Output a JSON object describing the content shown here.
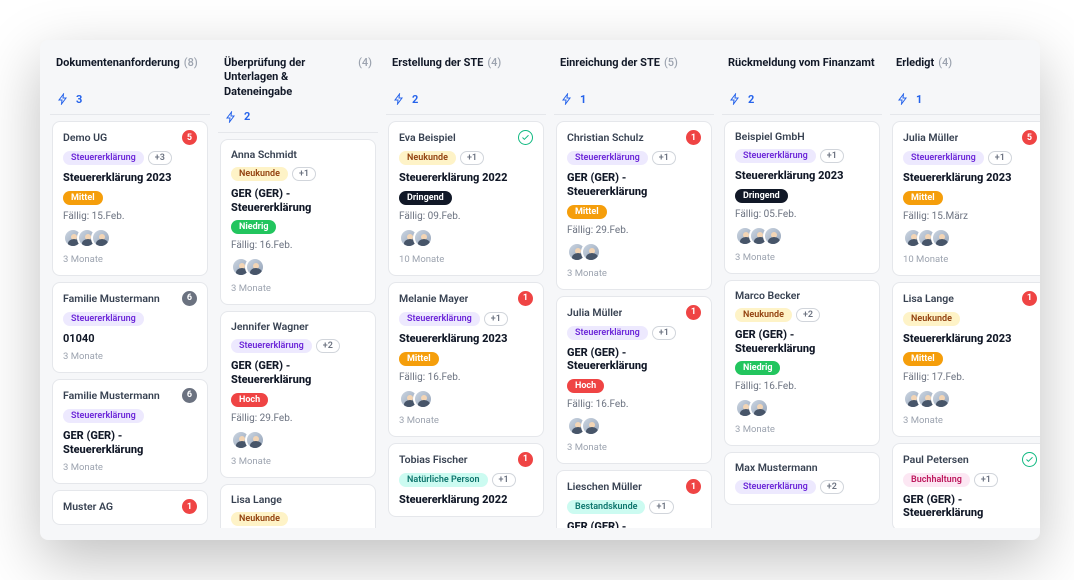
{
  "columns": [
    {
      "title": "Dokumentenanforderung",
      "count": "(8)",
      "filter": "3",
      "cards": [
        {
          "client": "Demo UG",
          "badge": {
            "type": "num",
            "color": "red",
            "value": "5"
          },
          "tags": [
            {
              "text": "Steuererklärung",
              "color": "purple"
            }
          ],
          "plus": "+3",
          "title": "Steuererklärung 2023",
          "prio": {
            "label": "Mittel",
            "class": "prio-mittel"
          },
          "due": "Fällig: 15.Feb.",
          "avatars": 3,
          "meta": "3 Monate"
        },
        {
          "client": "Familie Mustermann",
          "badge": {
            "type": "num",
            "color": "gray",
            "value": "6"
          },
          "tags": [
            {
              "text": "Steuererklärung",
              "color": "purple"
            }
          ],
          "title_code": "01040",
          "meta": "3 Monate"
        },
        {
          "client": "Familie Mustermann",
          "badge": {
            "type": "num",
            "color": "gray",
            "value": "6"
          },
          "tags": [
            {
              "text": "Steuererklärung",
              "color": "purple"
            }
          ],
          "title": "GER (GER) - Steuererklärung",
          "meta": "3 Monate"
        },
        {
          "client": "Muster AG",
          "badge": {
            "type": "num",
            "color": "red",
            "value": "1"
          }
        }
      ]
    },
    {
      "title": "Überprüfung der Unterlagen & Dateneingabe",
      "count": "(4)",
      "filter": "2",
      "cards": [
        {
          "client": "Anna Schmidt",
          "tags": [
            {
              "text": "Neukunde",
              "color": "yellow"
            }
          ],
          "plus": "+1",
          "title": "GER (GER) - Steuererklärung",
          "prio": {
            "label": "Niedrig",
            "class": "prio-niedrig"
          },
          "due": "Fällig: 16.Feb.",
          "avatars": 2,
          "meta": "3 Monate"
        },
        {
          "client": "Jennifer Wagner",
          "tags": [
            {
              "text": "Steuererklärung",
              "color": "purple"
            }
          ],
          "plus": "+2",
          "title": "GER (GER) - Steuererklärung",
          "prio": {
            "label": "Hoch",
            "class": "prio-hoch"
          },
          "due": "Fällig: 29.Feb.",
          "avatars": 2,
          "meta": "3 Monate"
        },
        {
          "client": "Lisa Lange",
          "tags": [
            {
              "text": "Neukunde",
              "color": "yellow"
            }
          ]
        }
      ]
    },
    {
      "title": "Erstellung der STE",
      "count": "(4)",
      "filter": "2",
      "cards": [
        {
          "client": "Eva Beispiel",
          "badge": {
            "type": "check"
          },
          "tags": [
            {
              "text": "Neukunde",
              "color": "yellow"
            }
          ],
          "plus": "+1",
          "title": "Steuererklärung 2022",
          "prio": {
            "label": "Dringend",
            "class": "prio-dringend"
          },
          "due": "Fällig: 09.Feb.",
          "avatars": 2,
          "meta": "10 Monate"
        },
        {
          "client": "Melanie Mayer",
          "badge": {
            "type": "num",
            "color": "red",
            "value": "1"
          },
          "tags": [
            {
              "text": "Steuererklärung",
              "color": "purple"
            }
          ],
          "plus": "+1",
          "title": "Steuererklärung 2023",
          "prio": {
            "label": "Mittel",
            "class": "prio-mittel"
          },
          "due": "Fällig: 16.Feb.",
          "avatars": 2,
          "meta": "3 Monate"
        },
        {
          "client": "Tobias Fischer",
          "badge": {
            "type": "num",
            "color": "red",
            "value": "1"
          },
          "tags": [
            {
              "text": "Natürliche Person",
              "color": "teal"
            }
          ],
          "plus": "+1",
          "title": "Steuererklärung 2022"
        }
      ]
    },
    {
      "title": "Einreichung der STE",
      "count": "(5)",
      "filter": "1",
      "cards": [
        {
          "client": "Christian Schulz",
          "badge": {
            "type": "num",
            "color": "red",
            "value": "1"
          },
          "tags": [
            {
              "text": "Steuererklärung",
              "color": "purple"
            }
          ],
          "plus": "+1",
          "title": "GER (GER) - Steuererklärung",
          "prio": {
            "label": "Mittel",
            "class": "prio-mittel"
          },
          "due": "Fällig: 29.Feb.",
          "avatars": 2,
          "meta": "3 Monate"
        },
        {
          "client": "Julia Müller",
          "badge": {
            "type": "num",
            "color": "red",
            "value": "1"
          },
          "tags": [
            {
              "text": "Steuererklärung",
              "color": "purple"
            }
          ],
          "plus": "+1",
          "title": "GER (GER) - Steuererklärung",
          "prio": {
            "label": "Hoch",
            "class": "prio-hoch"
          },
          "due": "Fällig: 16.Feb.",
          "avatars": 2,
          "meta": "3 Monate"
        },
        {
          "client": "Lieschen Müller",
          "badge": {
            "type": "num",
            "color": "red",
            "value": "1"
          },
          "tags": [
            {
              "text": "Bestandskunde",
              "color": "teal"
            }
          ],
          "plus": "+1",
          "title": "GER (GER) - Steuererklärung"
        }
      ]
    },
    {
      "title": "Rückmeldung vom Finanzamt",
      "count": "",
      "filter": "2",
      "cards": [
        {
          "client": "Beispiel GmbH",
          "tags": [
            {
              "text": "Steuererklärung",
              "color": "purple"
            }
          ],
          "plus": "+1",
          "title": "Steuererklärung 2023",
          "prio": {
            "label": "Dringend",
            "class": "prio-dringend"
          },
          "due": "Fällig: 05.Feb.",
          "avatars": 3,
          "meta": "3 Monate"
        },
        {
          "client": "Marco Becker",
          "tags": [
            {
              "text": "Neukunde",
              "color": "yellow"
            }
          ],
          "plus": "+2",
          "title": "GER (GER) - Steuererklärung",
          "prio": {
            "label": "Niedrig",
            "class": "prio-niedrig"
          },
          "due": "Fällig: 16.Feb.",
          "avatars": 2,
          "meta": "3 Monate"
        },
        {
          "client": "Max Mustermann",
          "tags": [
            {
              "text": "Steuererklärung",
              "color": "purple"
            }
          ],
          "plus": "+2"
        }
      ]
    },
    {
      "title": "Erledigt",
      "count": "(4)",
      "filter": "1",
      "cards": [
        {
          "client": "Julia Müller",
          "badge": {
            "type": "num",
            "color": "red",
            "value": "5"
          },
          "tags": [
            {
              "text": "Steuererklärung",
              "color": "purple"
            }
          ],
          "plus": "+1",
          "title": "Steuererklärung 2023",
          "prio": {
            "label": "Mittel",
            "class": "prio-mittel"
          },
          "due": "Fällig: 15.März",
          "avatars": 3,
          "meta": "10 Monate"
        },
        {
          "client": "Lisa Lange",
          "badge": {
            "type": "num",
            "color": "red",
            "value": "1"
          },
          "tags": [
            {
              "text": "Neukunde",
              "color": "yellow"
            }
          ],
          "title": "Steuererklärung 2023",
          "prio": {
            "label": "Mittel",
            "class": "prio-mittel"
          },
          "due": "Fällig: 17.Feb.",
          "avatars": 3,
          "meta": "3 Monate"
        },
        {
          "client": "Paul Petersen",
          "badge": {
            "type": "check"
          },
          "tags": [
            {
              "text": "Buchhaltung",
              "color": "pink"
            }
          ],
          "plus": "+1",
          "title": "GER (GER) - Steuererklärung"
        }
      ]
    }
  ]
}
